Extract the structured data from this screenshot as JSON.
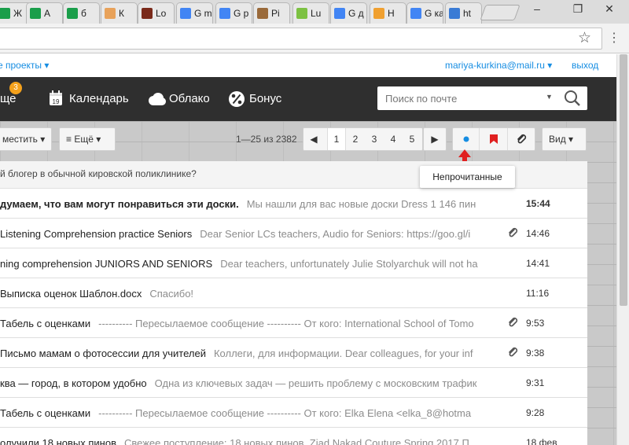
{
  "browser": {
    "tabs": [
      {
        "label": "Ж",
        "icon": "sheets-icon",
        "color": "#1a9e4a"
      },
      {
        "label": "А",
        "icon": "sheets-icon",
        "color": "#1a9e4a"
      },
      {
        "label": "б",
        "icon": "sheets-icon",
        "color": "#1a9e4a"
      },
      {
        "label": "К",
        "icon": "ribbon-icon",
        "color": "#e8a25a"
      },
      {
        "label": "Lo",
        "icon": "avatar-icon",
        "color": "#7a2a1a"
      },
      {
        "label": "G m",
        "icon": "google-icon",
        "color": "#4285f4"
      },
      {
        "label": "G p",
        "icon": "google-icon",
        "color": "#4285f4"
      },
      {
        "label": "Pi",
        "icon": "image-icon",
        "color": "#9a6a3a"
      },
      {
        "label": "Lu",
        "icon": "ee-icon",
        "color": "#7cc142"
      },
      {
        "label": "G д",
        "icon": "google-icon",
        "color": "#4285f4"
      },
      {
        "label": "Н",
        "icon": "arrow-up-icon",
        "color": "#f0a030"
      },
      {
        "label": "G ка",
        "icon": "google-icon",
        "color": "#4285f4"
      },
      {
        "label": "ht",
        "icon": "help-icon",
        "color": "#3a7bd5"
      }
    ],
    "window_controls": [
      "minimize",
      "restore",
      "close"
    ]
  },
  "portal": {
    "projects_label": "е проекты ▾",
    "user_email": "mariya-kurkina@mail.ru ▾",
    "logout_label": "выход"
  },
  "header": {
    "more_label": "ще",
    "more_badge": "3",
    "calendar_label": "Календарь",
    "calendar_icon_text": "19",
    "cloud_label": "Облако",
    "bonus_label": "Бонус",
    "search_placeholder": "Поиск по почте"
  },
  "toolbar": {
    "move_label": "местить ▾",
    "more_label": "≡ Ещё ▾",
    "pagination_info": "1—25 из 2382",
    "pages": [
      "1",
      "2",
      "3",
      "4",
      "5"
    ],
    "active_page": "1",
    "view_label": "Вид ▾",
    "unread_tooltip": "Непрочитанные",
    "accent_red": "#e02020",
    "accent_blue": "#168de2"
  },
  "mail": {
    "top_strip": "й блогер в обычной кировской поликлинике?",
    "rows": [
      {
        "subject": "думаем, что вам могут понравиться эти доски.",
        "snippet": "Мы нашли для вас новые доски Dress 1 146 пин",
        "time": "15:44",
        "unread": true,
        "attachment": false
      },
      {
        "subject": "Listening Comprehension practice Seniors",
        "snippet": "Dear Senior LCs teachers, Audio for Seniors: https://goo.gl/i",
        "time": "14:46",
        "unread": false,
        "attachment": true
      },
      {
        "subject": "ning comprehension JUNIORS AND SENIORS",
        "snippet": "Dear teachers, unfortunately Julie Stolyarchuk will not ha",
        "time": "14:41",
        "unread": false,
        "attachment": false
      },
      {
        "subject": "Выписка оценок Шаблон.docx",
        "snippet": "Спасибо!",
        "time": "11:16",
        "unread": false,
        "attachment": false
      },
      {
        "subject": "Табель с оценками",
        "snippet": "---------- Пересылаемое сообщение ---------- От кого: International School of Tomo",
        "time": "9:53",
        "unread": false,
        "attachment": true
      },
      {
        "subject": "Письмо мамам о фотосессии для учителей",
        "snippet": "Коллеги, для информации. Dear colleagues, for your inf",
        "time": "9:38",
        "unread": false,
        "attachment": true
      },
      {
        "subject": "ква — город, в котором удобно",
        "snippet": "Одна из ключевых задач — решить проблему с московским трафик",
        "time": "9:31",
        "unread": false,
        "attachment": false
      },
      {
        "subject": "Табель с оценками",
        "snippet": "---------- Пересылаемое сообщение ---------- От кого: Elka Elena <elka_8@hotma",
        "time": "9:28",
        "unread": false,
        "attachment": false
      },
      {
        "subject": "олучили 18 новых пинов",
        "snippet": "Свежее поступление: 18 новых пинов. Ziad Nakad Couture Spring 2017 П",
        "time": "18 фев",
        "unread": false,
        "attachment": false
      }
    ]
  }
}
